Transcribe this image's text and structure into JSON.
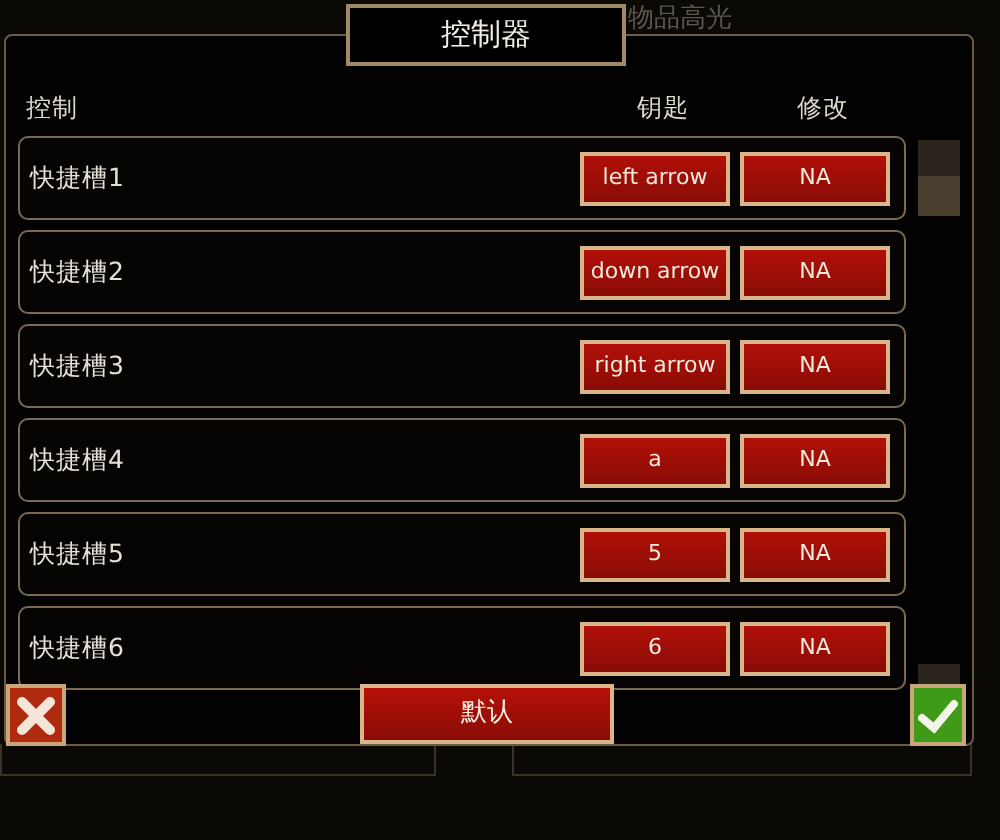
{
  "background_label": "物品高光",
  "dialog": {
    "title": "控制器",
    "columns": [
      "控制",
      "钥匙",
      "修改"
    ],
    "rows": [
      {
        "name": "快捷槽1",
        "key": "left arrow",
        "modifier": "NA"
      },
      {
        "name": "快捷槽2",
        "key": "down arrow",
        "modifier": "NA"
      },
      {
        "name": "快捷槽3",
        "key": "right arrow",
        "modifier": "NA"
      },
      {
        "name": "快捷槽4",
        "key": "a",
        "modifier": "NA"
      },
      {
        "name": "快捷槽5",
        "key": "5",
        "modifier": "NA"
      },
      {
        "name": "快捷槽6",
        "key": "6",
        "modifier": "NA"
      }
    ],
    "default_button": "默认"
  }
}
